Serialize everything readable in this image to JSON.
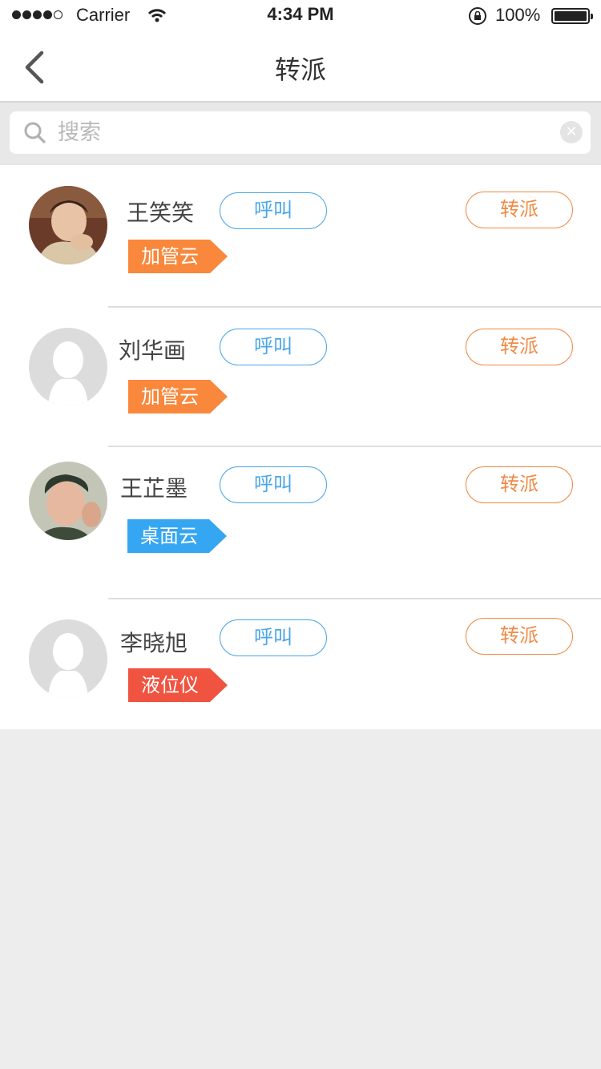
{
  "status_bar": {
    "carrier": "Carrier",
    "time": "4:34 PM",
    "battery": "100%"
  },
  "nav": {
    "title": "转派"
  },
  "search": {
    "placeholder": "搜索",
    "value": ""
  },
  "colors": {
    "call": "#4aa6e8",
    "assign": "#f08a45",
    "tag_orange": "#f9883c",
    "tag_blue": "#35a6f2",
    "tag_red": "#f0533f"
  },
  "contacts": [
    {
      "name": "王笑笑",
      "call_label": "呼叫",
      "assign_label": "转派",
      "tag": "加管云",
      "tag_color": "#f9883c",
      "avatar": "photo-avatar-icon"
    },
    {
      "name": "刘华画",
      "call_label": "呼叫",
      "assign_label": "转派",
      "tag": "加管云",
      "tag_color": "#f9883c",
      "avatar": "default-avatar-icon"
    },
    {
      "name": "王芷墨",
      "call_label": "呼叫",
      "assign_label": "转派",
      "tag": "桌面云",
      "tag_color": "#35a6f2",
      "avatar": "photo-avatar-icon"
    },
    {
      "name": "李晓旭",
      "call_label": "呼叫",
      "assign_label": "转派",
      "tag": "液位仪",
      "tag_color": "#f0533f",
      "avatar": "default-avatar-icon"
    }
  ]
}
